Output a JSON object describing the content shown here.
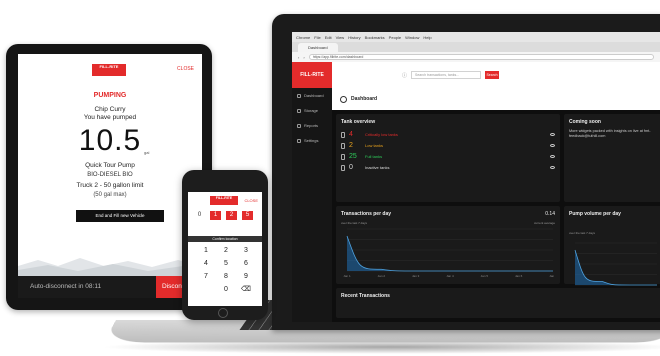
{
  "laptop": {
    "browser_menu": [
      "Chrome",
      "File",
      "Edit",
      "View",
      "History",
      "Bookmarks",
      "People",
      "Window",
      "Help"
    ],
    "tab_title": "Dashboard",
    "url": "https://app.fillrite.com/dashboard",
    "logo_text": "FILL-RITE",
    "search_placeholder": "Search transactions, tanks...",
    "search_button": "Search",
    "page_title": "Dashboard",
    "sidebar": [
      {
        "label": "Dashboard"
      },
      {
        "label": "Storage"
      },
      {
        "label": "Reports"
      },
      {
        "label": "Settings"
      }
    ],
    "tank_overview": {
      "title": "Tank overview",
      "rows": [
        {
          "num": "4",
          "label": "Critically low tanks",
          "color": "#e32b2b"
        },
        {
          "num": "2",
          "label": "Low tanks",
          "color": "#e8a21d"
        },
        {
          "num": "25",
          "label": "Full tanks",
          "color": "#2ecc5a"
        },
        {
          "num": "0",
          "label": "Inactive tanks",
          "color": "#dddddd"
        }
      ]
    },
    "coming_soon": {
      "title": "Coming soon",
      "text": "More widgets packed with insights on live at fmt-feedback@tuthill.com"
    },
    "transactions": {
      "title": "Transactions per day",
      "subtitle": "over the last 7 days",
      "value": "0.14",
      "value_sub": "current average"
    },
    "pump_volume": {
      "title": "Pump volume per day",
      "subtitle": "over the last 7 days"
    },
    "recent": {
      "title": "Recent Transactions"
    }
  },
  "chart_data": [
    {
      "type": "area",
      "title": "Transactions per day",
      "x": [
        "Jan 1",
        "Jan 2",
        "Jan 3",
        "Jan 4",
        "Jan 5",
        "Jan 6",
        "Jan 7"
      ],
      "y": [
        1.0,
        0.05,
        0,
        0,
        0,
        0,
        0
      ],
      "ylabel": "",
      "ylim": [
        0,
        1.2
      ],
      "series_color": "#1f6fb5"
    },
    {
      "type": "area",
      "title": "Pump volume per day",
      "y": [
        1.0,
        0.1,
        0,
        0
      ],
      "ylim": [
        0,
        1.2
      ],
      "series_color": "#1f6fb5"
    }
  ],
  "tablet": {
    "logo_text": "FILL-RITE",
    "close": "CLOSE",
    "status": "PUMPING",
    "driver": "Chip Curry",
    "you_have_pumped": "You have pumped",
    "amount": "10.5",
    "unit": "gal",
    "pump": "Quick Tour Pump",
    "fuel": "BIO-DIESEL BIO",
    "truck": "Truck 2 - 50 gallon limit",
    "max": "(50 gal max)",
    "end_button": "End and Fill new Vehicle",
    "auto_disconnect": "Auto-disconnect in 08:11",
    "disconnect_button": "Disconnect"
  },
  "phone": {
    "logo_text": "FILL-RITE",
    "close": "CLOSE",
    "tiles": [
      "0",
      "1",
      "2",
      "5"
    ],
    "header": "Confirm location",
    "keys": [
      "1",
      "2",
      "3",
      "4",
      "5",
      "6",
      "7",
      "8",
      "9",
      "",
      "0",
      "⌫"
    ]
  }
}
